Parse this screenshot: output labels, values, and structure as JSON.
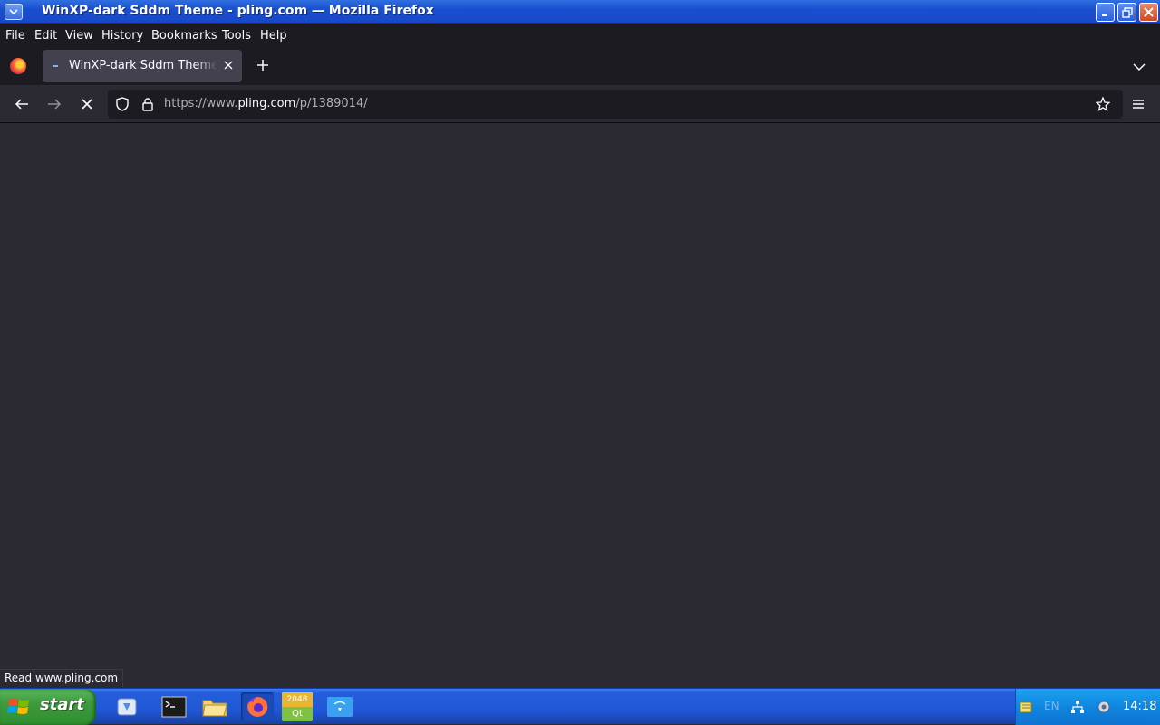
{
  "window": {
    "title": "WinXP-dark Sddm Theme - pling.com — Mozilla Firefox",
    "sysmenu_icon": "chevron-down-icon",
    "buttons": {
      "minimize": "minimize-icon",
      "maximize": "restore-icon",
      "close": "close-icon"
    }
  },
  "menubar": {
    "items": [
      {
        "label": "File"
      },
      {
        "label": "Edit"
      },
      {
        "label": "View"
      },
      {
        "label": "History"
      },
      {
        "label": "Bookmarks"
      },
      {
        "label": "Tools"
      },
      {
        "label": "Help"
      }
    ]
  },
  "tabs": {
    "items": [
      {
        "label": "WinXP-dark Sddm Theme - pling.com",
        "active": true
      }
    ],
    "new_tab_icon": "plus-icon",
    "list_all_tabs_icon": "chevron-down-icon"
  },
  "navbar": {
    "back_icon": "arrow-left-icon",
    "forward_icon": "arrow-right-icon",
    "stop_icon": "stop-x-icon",
    "url_prefix": "https://www.",
    "url_host": "pling.com",
    "url_path": "/p/1389014/",
    "bookmark_icon": "star-icon",
    "menu_icon": "hamburger-icon"
  },
  "status": {
    "text": "Read www.pling.com"
  },
  "taskbar": {
    "start_label": "start",
    "apps": [
      {
        "name": "file-manager-app",
        "icon": "file-manager-icon",
        "active": false
      },
      {
        "name": "terminal-app",
        "icon": "terminal-icon",
        "active": false
      },
      {
        "name": "folder-app",
        "icon": "folder-icon",
        "active": false
      },
      {
        "name": "firefox-app",
        "icon": "firefox-icon",
        "active": true
      },
      {
        "name": "2048-qt-app",
        "icon": "2048-qt-icon",
        "active": false,
        "text_top": "2048",
        "text_bottom": "Qt"
      },
      {
        "name": "remote-app",
        "icon": "remote-desktop-icon",
        "active": false
      }
    ],
    "tray": {
      "language": "EN",
      "clock": "14:18"
    }
  },
  "colors": {
    "toolbar": "#2b2a33",
    "tabstrip": "#1c1b22",
    "active_tab": "#42414d",
    "titlebar": "#1a4fd0",
    "taskbar": "#245edb",
    "start": "#3d9a3d",
    "tray": "#0f86e0"
  }
}
